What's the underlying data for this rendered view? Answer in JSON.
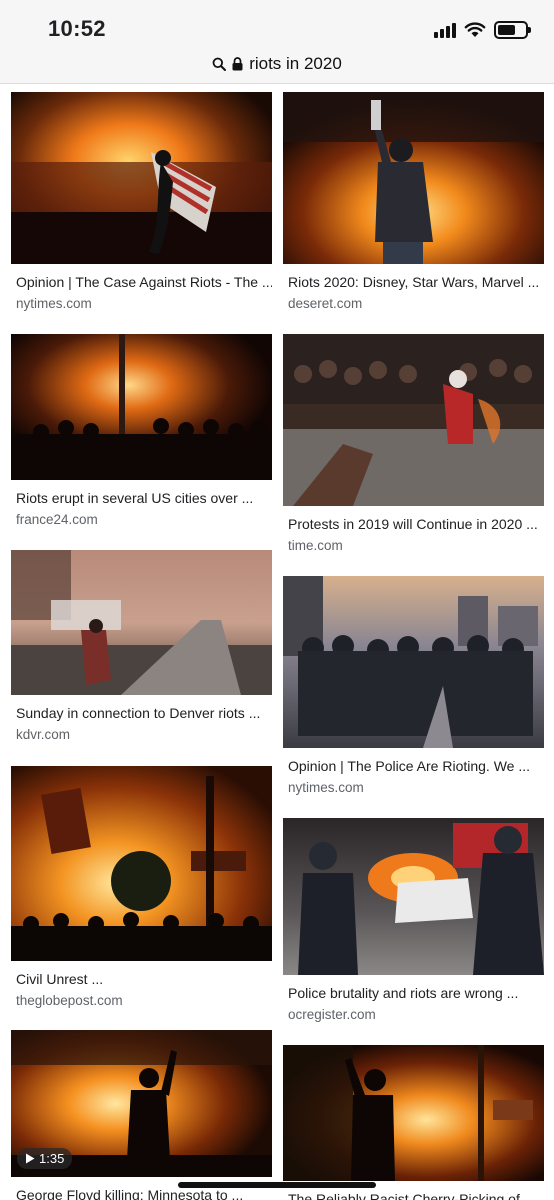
{
  "status": {
    "time": "10:52"
  },
  "browser": {
    "search_query": "riots in 2020"
  },
  "results": [
    {
      "caption": "Opinion | The Case Against Riots - The ...",
      "source": "nytimes.com",
      "thumb": "flag"
    },
    {
      "caption": "Riots 2020: Disney, Star Wars, Marvel ...",
      "source": "deseret.com",
      "thumb": "fire-raise"
    },
    {
      "caption": "Riots erupt in several US cities over ...",
      "source": "france24.com",
      "thumb": "crowd-fire"
    },
    {
      "caption": "Protests in 2019 will Continue in 2020 ...",
      "source": "time.com",
      "thumb": "crowd-day"
    },
    {
      "caption": "Sunday in connection to Denver riots ...",
      "source": "kdvr.com",
      "thumb": "smoke-street"
    },
    {
      "caption": "Opinion | The Police Are Rioting. We ...",
      "source": "nytimes.com",
      "thumb": "police-line"
    },
    {
      "caption": "Civil Unrest ...",
      "source": "theglobepost.com",
      "thumb": "building-fire"
    },
    {
      "caption": "Police brutality and riots are wrong ...",
      "source": "ocregister.com",
      "thumb": "police-car"
    },
    {
      "caption": "George Floyd killing: Minnesota to ...",
      "source": "",
      "thumb": "silhouette",
      "duration": "1:35"
    },
    {
      "caption": "The Reliably Racist Cherry-Picking of ...",
      "source": "",
      "thumb": "silhouette2"
    }
  ],
  "icons": {
    "search": "search-icon",
    "lock": "lock-icon",
    "play": "play-icon"
  }
}
